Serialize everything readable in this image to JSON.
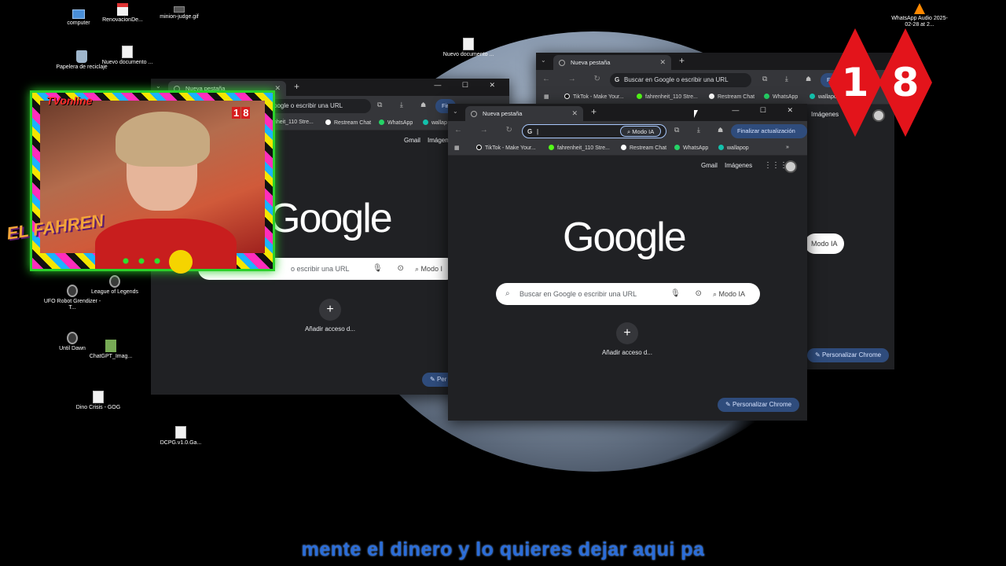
{
  "desktop": {
    "icons": [
      {
        "label": "computer",
        "glyph": "pc-icon"
      },
      {
        "label": "RenovacionDe...",
        "glyph": "pdf-icon"
      },
      {
        "label": "minion-judge.gif",
        "glyph": "gif-icon"
      },
      {
        "label": "Papelera de reciclaje",
        "glyph": "bin-icon"
      },
      {
        "label": "Nuevo documento ...",
        "glyph": "doc-icon"
      },
      {
        "label": "Nuevo documento ...",
        "glyph": "doc-icon"
      },
      {
        "label": "UFO Robot Grendizer - T...",
        "glyph": "game-icon"
      },
      {
        "label": "League of Legends",
        "glyph": "game-icon"
      },
      {
        "label": "Until Dawn",
        "glyph": "game-icon"
      },
      {
        "label": "ChatGPT_Imag...",
        "glyph": "exe-icon"
      },
      {
        "label": "Dino Crisis - GOG",
        "glyph": "doc-icon"
      },
      {
        "label": "DCPG.v1.0.Ga...",
        "glyph": "doc-icon"
      },
      {
        "label": "WhatsApp Audio 2025-02-28 at 2...",
        "glyph": "vlc-icon"
      }
    ]
  },
  "browser": {
    "tab_title": "Nueva pestaña",
    "omnibox_placeholder": "Buscar en Google o escribir una URL",
    "omnibox_placeholder_cut": "oogle o escribir una URL",
    "modo_ia": "Modo IA",
    "update_label": "Finalizar actualización",
    "update_short": "Fi",
    "update_cut": "Fin",
    "bookmarks": [
      {
        "label": "TikTok - Make Your...",
        "color": "#111111"
      },
      {
        "label": "fahrenheit_110 Stre...",
        "color": "#53fc18"
      },
      {
        "label": "Restream Chat",
        "color": "#ffffff"
      },
      {
        "label": "WhatsApp",
        "color": "#25d366"
      },
      {
        "label": "wallapop",
        "color": "#13c1ac"
      }
    ],
    "bm_cut": {
      "a": "fahrenheit_110 Stre...",
      "b": "wallap",
      "c": "wallapo"
    },
    "gmail": "Gmail",
    "images": "Imágenes",
    "logo": "Google",
    "search_placeholder": "Buscar en Google o escribir una URL",
    "search_left_cut": "Buscar",
    "search_left_rest": "o escribir una URL",
    "modo_cut": "Modo I",
    "add_shortcut": "Añadir acceso d...",
    "personalize": "Personalizar Chrome",
    "personalize_cut": "Per",
    "accent": "#a8c7fa"
  },
  "overlay": {
    "tv_online": "TVonline",
    "brand": "EL FAHREN",
    "rating": [
      "1",
      "8"
    ]
  },
  "subtitle": "mente el dinero y lo quieres dejar aqui pa"
}
